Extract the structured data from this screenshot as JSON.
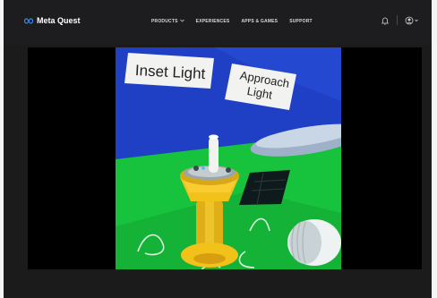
{
  "brand": {
    "name": "Meta Quest",
    "logo_icon": "meta-infinity-logo",
    "accent": "#2f88ff"
  },
  "nav": {
    "products": "PRODUCTS",
    "experiences": "EXPERIENCES",
    "apps_games": "APPS & GAMES",
    "support": "SUPPORT"
  },
  "nav_right_icons": [
    "notifications-bell-icon",
    "account-avatar-icon"
  ],
  "video": {
    "labels": {
      "inset_light": "Inset Light",
      "approach_light_line1": "Approach",
      "approach_light_line2": "Light"
    }
  },
  "colors": {
    "page_bg": "#1b1b1c",
    "sky": "#1f3fc4",
    "ground": "#17c23c",
    "fixture": "#f2c21a"
  }
}
